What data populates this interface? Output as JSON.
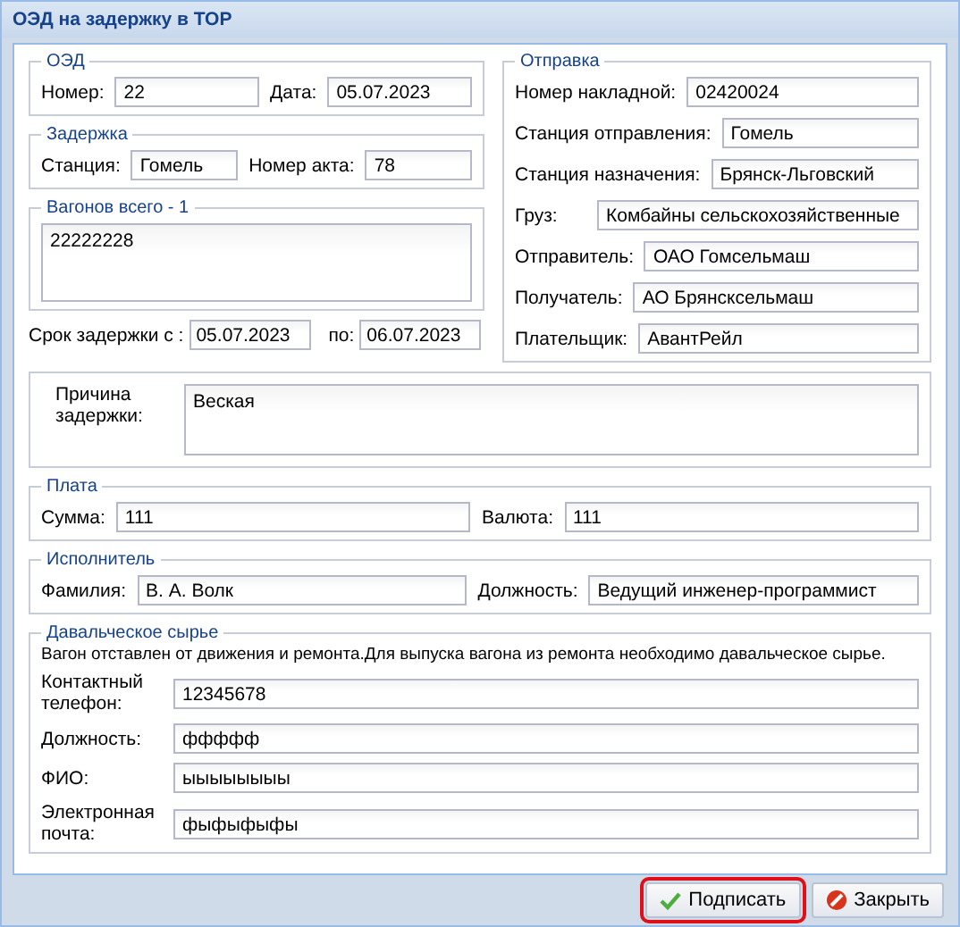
{
  "window": {
    "title": "ОЭД на задержку в ТОР"
  },
  "oed": {
    "legend": "ОЭД",
    "fields": [
      {
        "label": "Номер:",
        "value": "22"
      },
      {
        "label": "Дата:",
        "value": "05.07.2023"
      }
    ]
  },
  "delay": {
    "legend": "Задержка",
    "fields": [
      {
        "label": "Станция:",
        "value": "Гомель"
      },
      {
        "label": "Номер акта:",
        "value": "78"
      }
    ]
  },
  "wagons": {
    "legend": "Вагонов всего - 1",
    "value": "22222228"
  },
  "period": {
    "fields": [
      {
        "label": "Срок задержки с :",
        "value": "05.07.2023"
      },
      {
        "label": "по:",
        "value": "06.07.2023"
      }
    ]
  },
  "shipment": {
    "legend": "Отправка",
    "fields": [
      {
        "label": "Номер накладной:",
        "value": "02420024"
      },
      {
        "label": "Станция отправления:",
        "value": "Гомель"
      },
      {
        "label": "Станция назначения:",
        "value": "Брянск-Льговский"
      },
      {
        "label": "Груз:",
        "value": "Комбайны сельскохозяйственные"
      },
      {
        "label": "Отправитель:",
        "value": "ОАО Гомсельмаш"
      },
      {
        "label": "Получатель:",
        "value": "АО  Брянсксельмаш"
      },
      {
        "label": "Плательщик:",
        "value": "АвантРейл"
      }
    ]
  },
  "reason": {
    "label": "Причина задержки:",
    "value": "Веская"
  },
  "payment": {
    "legend": "Плата",
    "fields": [
      {
        "label": "Сумма:",
        "value": "111"
      },
      {
        "label": "Валюта:",
        "value": "111"
      }
    ]
  },
  "executor": {
    "legend": "Исполнитель",
    "fields": [
      {
        "label": "Фамилия:",
        "value": "В. А. Волк"
      },
      {
        "label": "Должность:",
        "value": "Ведущий инженер-программист"
      }
    ]
  },
  "raw_material": {
    "legend": "Давальческое сырье",
    "note": "Вагон отставлен от движения и ремонта.Для выпуска вагона из ремонта необходимо давальческое сырье.",
    "fields": [
      {
        "label": "Контактный телефон:",
        "value": "12345678"
      },
      {
        "label": "Должность:",
        "value": "ффффф"
      },
      {
        "label": "ФИО:",
        "value": "ыыыыыыыы"
      },
      {
        "label": "Электронная почта:",
        "value": "фыфыфыфы"
      }
    ]
  },
  "buttons": [
    {
      "label": "Подписать",
      "kind": "sign",
      "highlighted": true
    },
    {
      "label": "Закрыть",
      "kind": "close",
      "highlighted": false
    }
  ]
}
